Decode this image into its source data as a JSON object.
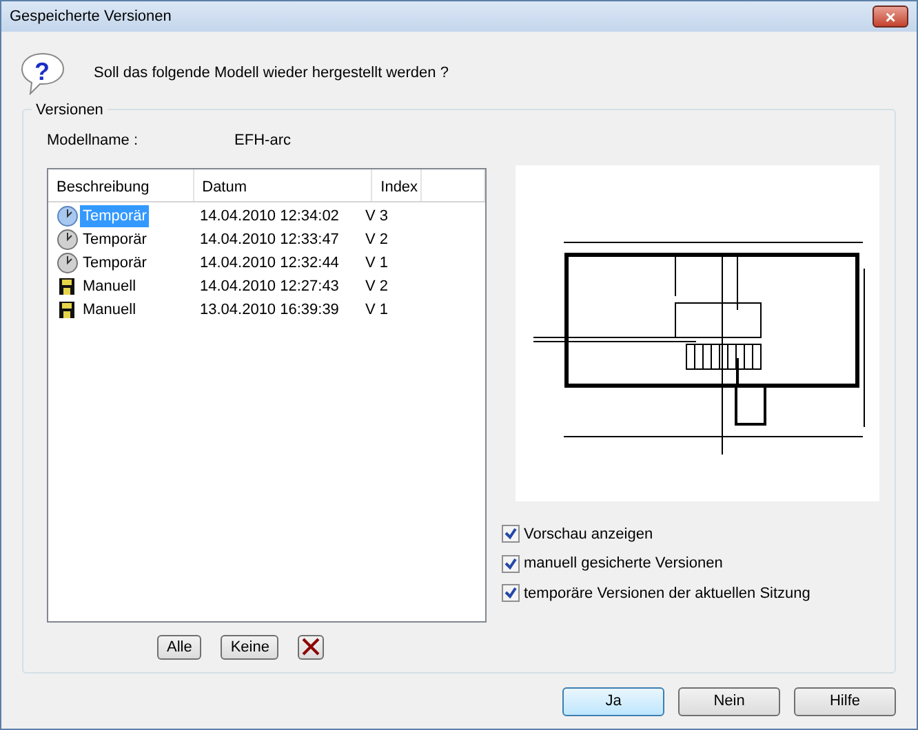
{
  "window": {
    "title": "Gespeicherte Versionen",
    "close": "×"
  },
  "question_icon": "?",
  "question": "Soll das folgende Modell wieder hergestellt werden ?",
  "group": {
    "title": "Versionen"
  },
  "model": {
    "label": "Modellname :",
    "value": "EFH-arc"
  },
  "table": {
    "columns": [
      "Beschreibung",
      "Datum",
      "Index"
    ],
    "rows": [
      {
        "kind": "temporary",
        "description": "Temporär",
        "date": "14.04.2010 12:34:02",
        "index": "V 3",
        "selected": true
      },
      {
        "kind": "temporary",
        "description": "Temporär",
        "date": "14.04.2010 12:33:47",
        "index": "V 2",
        "selected": false
      },
      {
        "kind": "temporary",
        "description": "Temporär",
        "date": "14.04.2010 12:32:44",
        "index": "V 1",
        "selected": false
      },
      {
        "kind": "manual",
        "description": "Manuell",
        "date": "14.04.2010 12:27:43",
        "index": "V 2",
        "selected": false
      },
      {
        "kind": "manual",
        "description": "Manuell",
        "date": "13.04.2010 16:39:39",
        "index": "V 1",
        "selected": false
      }
    ]
  },
  "list_buttons": [
    "Alle",
    "Keine"
  ],
  "options": [
    {
      "label": "Vorschau anzeigen",
      "checked": true
    },
    {
      "label": "manuell gesicherte Versionen",
      "checked": true
    },
    {
      "label": "temporäre Versionen der aktuellen Sitzung",
      "checked": true
    }
  ],
  "buttons": [
    {
      "label": "Ja",
      "default": true
    },
    {
      "label": "Nein",
      "default": false
    },
    {
      "label": "Hilfe",
      "default": false
    }
  ]
}
